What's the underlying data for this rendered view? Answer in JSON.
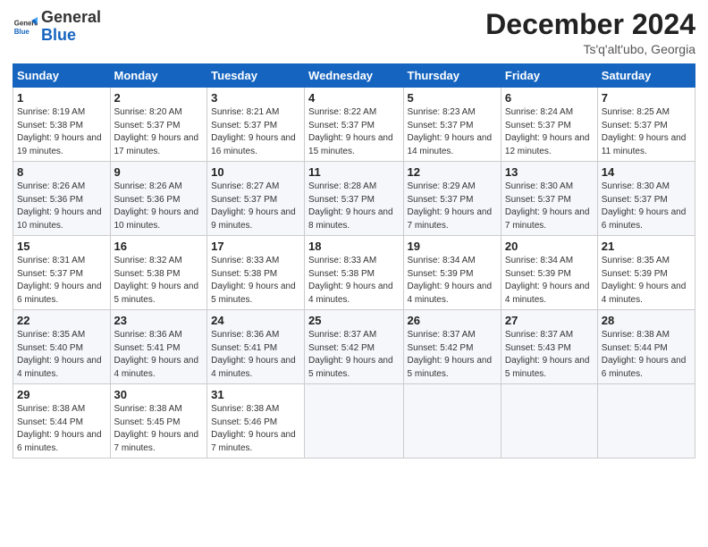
{
  "header": {
    "logo_general": "General",
    "logo_blue": "Blue",
    "month_title": "December 2024",
    "location": "Ts'q'alt'ubo, Georgia"
  },
  "weekdays": [
    "Sunday",
    "Monday",
    "Tuesday",
    "Wednesday",
    "Thursday",
    "Friday",
    "Saturday"
  ],
  "weeks": [
    [
      {
        "day": "1",
        "sunrise": "8:19 AM",
        "sunset": "5:38 PM",
        "daylight": "9 hours and 19 minutes."
      },
      {
        "day": "2",
        "sunrise": "8:20 AM",
        "sunset": "5:37 PM",
        "daylight": "9 hours and 17 minutes."
      },
      {
        "day": "3",
        "sunrise": "8:21 AM",
        "sunset": "5:37 PM",
        "daylight": "9 hours and 16 minutes."
      },
      {
        "day": "4",
        "sunrise": "8:22 AM",
        "sunset": "5:37 PM",
        "daylight": "9 hours and 15 minutes."
      },
      {
        "day": "5",
        "sunrise": "8:23 AM",
        "sunset": "5:37 PM",
        "daylight": "9 hours and 14 minutes."
      },
      {
        "day": "6",
        "sunrise": "8:24 AM",
        "sunset": "5:37 PM",
        "daylight": "9 hours and 12 minutes."
      },
      {
        "day": "7",
        "sunrise": "8:25 AM",
        "sunset": "5:37 PM",
        "daylight": "9 hours and 11 minutes."
      }
    ],
    [
      {
        "day": "8",
        "sunrise": "8:26 AM",
        "sunset": "5:36 PM",
        "daylight": "9 hours and 10 minutes."
      },
      {
        "day": "9",
        "sunrise": "8:26 AM",
        "sunset": "5:36 PM",
        "daylight": "9 hours and 10 minutes."
      },
      {
        "day": "10",
        "sunrise": "8:27 AM",
        "sunset": "5:37 PM",
        "daylight": "9 hours and 9 minutes."
      },
      {
        "day": "11",
        "sunrise": "8:28 AM",
        "sunset": "5:37 PM",
        "daylight": "9 hours and 8 minutes."
      },
      {
        "day": "12",
        "sunrise": "8:29 AM",
        "sunset": "5:37 PM",
        "daylight": "9 hours and 7 minutes."
      },
      {
        "day": "13",
        "sunrise": "8:30 AM",
        "sunset": "5:37 PM",
        "daylight": "9 hours and 7 minutes."
      },
      {
        "day": "14",
        "sunrise": "8:30 AM",
        "sunset": "5:37 PM",
        "daylight": "9 hours and 6 minutes."
      }
    ],
    [
      {
        "day": "15",
        "sunrise": "8:31 AM",
        "sunset": "5:37 PM",
        "daylight": "9 hours and 6 minutes."
      },
      {
        "day": "16",
        "sunrise": "8:32 AM",
        "sunset": "5:38 PM",
        "daylight": "9 hours and 5 minutes."
      },
      {
        "day": "17",
        "sunrise": "8:33 AM",
        "sunset": "5:38 PM",
        "daylight": "9 hours and 5 minutes."
      },
      {
        "day": "18",
        "sunrise": "8:33 AM",
        "sunset": "5:38 PM",
        "daylight": "9 hours and 4 minutes."
      },
      {
        "day": "19",
        "sunrise": "8:34 AM",
        "sunset": "5:39 PM",
        "daylight": "9 hours and 4 minutes."
      },
      {
        "day": "20",
        "sunrise": "8:34 AM",
        "sunset": "5:39 PM",
        "daylight": "9 hours and 4 minutes."
      },
      {
        "day": "21",
        "sunrise": "8:35 AM",
        "sunset": "5:39 PM",
        "daylight": "9 hours and 4 minutes."
      }
    ],
    [
      {
        "day": "22",
        "sunrise": "8:35 AM",
        "sunset": "5:40 PM",
        "daylight": "9 hours and 4 minutes."
      },
      {
        "day": "23",
        "sunrise": "8:36 AM",
        "sunset": "5:41 PM",
        "daylight": "9 hours and 4 minutes."
      },
      {
        "day": "24",
        "sunrise": "8:36 AM",
        "sunset": "5:41 PM",
        "daylight": "9 hours and 4 minutes."
      },
      {
        "day": "25",
        "sunrise": "8:37 AM",
        "sunset": "5:42 PM",
        "daylight": "9 hours and 5 minutes."
      },
      {
        "day": "26",
        "sunrise": "8:37 AM",
        "sunset": "5:42 PM",
        "daylight": "9 hours and 5 minutes."
      },
      {
        "day": "27",
        "sunrise": "8:37 AM",
        "sunset": "5:43 PM",
        "daylight": "9 hours and 5 minutes."
      },
      {
        "day": "28",
        "sunrise": "8:38 AM",
        "sunset": "5:44 PM",
        "daylight": "9 hours and 6 minutes."
      }
    ],
    [
      {
        "day": "29",
        "sunrise": "8:38 AM",
        "sunset": "5:44 PM",
        "daylight": "9 hours and 6 minutes."
      },
      {
        "day": "30",
        "sunrise": "8:38 AM",
        "sunset": "5:45 PM",
        "daylight": "9 hours and 7 minutes."
      },
      {
        "day": "31",
        "sunrise": "8:38 AM",
        "sunset": "5:46 PM",
        "daylight": "9 hours and 7 minutes."
      },
      null,
      null,
      null,
      null
    ]
  ],
  "labels": {
    "sunrise": "Sunrise:",
    "sunset": "Sunset:",
    "daylight": "Daylight:"
  }
}
